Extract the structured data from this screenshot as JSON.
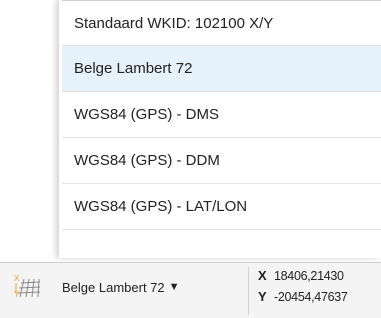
{
  "menu": {
    "items": [
      {
        "label": "Standaard WKID: 102100 X/Y",
        "selected": false
      },
      {
        "label": "Belge Lambert 72",
        "selected": true
      },
      {
        "label": "WGS84 (GPS) - DMS",
        "selected": false
      },
      {
        "label": "WGS84 (GPS) - DDM",
        "selected": false
      },
      {
        "label": "WGS84 (GPS) - LAT/LON",
        "selected": false
      }
    ]
  },
  "statusbar": {
    "projection_label": "Belge Lambert 72",
    "dropdown_icon": "caret-down-icon",
    "x_label": "X",
    "x_value": "18406,21430",
    "y_label": "Y",
    "y_value": "-20454,47637"
  },
  "colors": {
    "selected_bg": "#e5f1fb",
    "icon_accent": "#f0a020"
  }
}
